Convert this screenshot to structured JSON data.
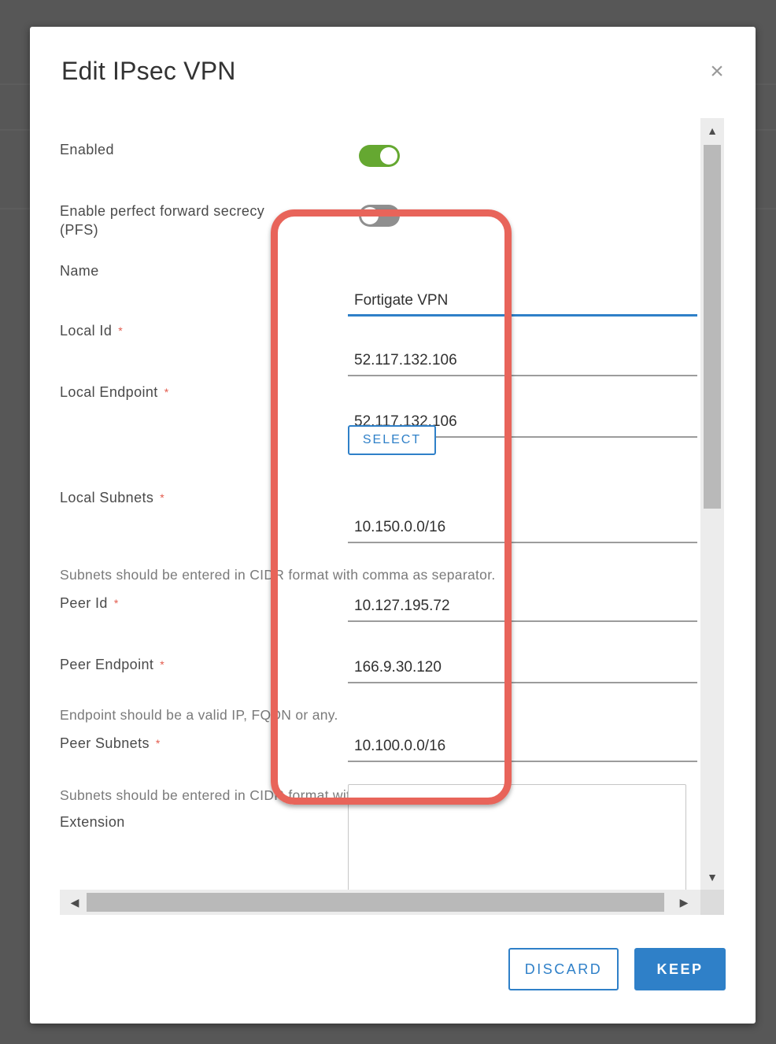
{
  "dialog": {
    "title": "Edit IPsec VPN",
    "close_icon": "close-icon"
  },
  "form": {
    "enabled": {
      "label": "Enabled",
      "state": "on"
    },
    "pfs": {
      "label_line1": "Enable perfect forward secrecy",
      "label_line2": "(PFS)",
      "state": "off"
    },
    "name": {
      "label": "Name",
      "value": "Fortigate VPN"
    },
    "local_id": {
      "label": "Local Id",
      "required": "*",
      "value": "52.117.132.106"
    },
    "local_endpoint": {
      "label": "Local Endpoint",
      "required": "*",
      "value": "52.117.132.106",
      "select_label": "SELECT"
    },
    "local_subnets": {
      "label": "Local Subnets",
      "required": "*",
      "value": "10.150.0.0/16",
      "hint": "Subnets should be entered in CIDR format with comma as separator."
    },
    "peer_id": {
      "label": "Peer Id",
      "required": "*",
      "value": "10.127.195.72"
    },
    "peer_endpoint": {
      "label": "Peer Endpoint",
      "required": "*",
      "value": "166.9.30.120",
      "hint": "Endpoint should be a valid IP, FQDN or any."
    },
    "peer_subnets": {
      "label": "Peer Subnets",
      "required": "*",
      "value": "10.100.0.0/16",
      "hint": "Subnets should be entered in CIDR format with comma as separator."
    },
    "extension": {
      "label": "Extension",
      "value": ""
    }
  },
  "footer": {
    "discard_label": "DISCARD",
    "keep_label": "KEEP"
  },
  "colors": {
    "accent": "#2f80c8",
    "toggle_on": "#65a831",
    "required": "#e35b4d",
    "highlight": "#e8645a"
  }
}
